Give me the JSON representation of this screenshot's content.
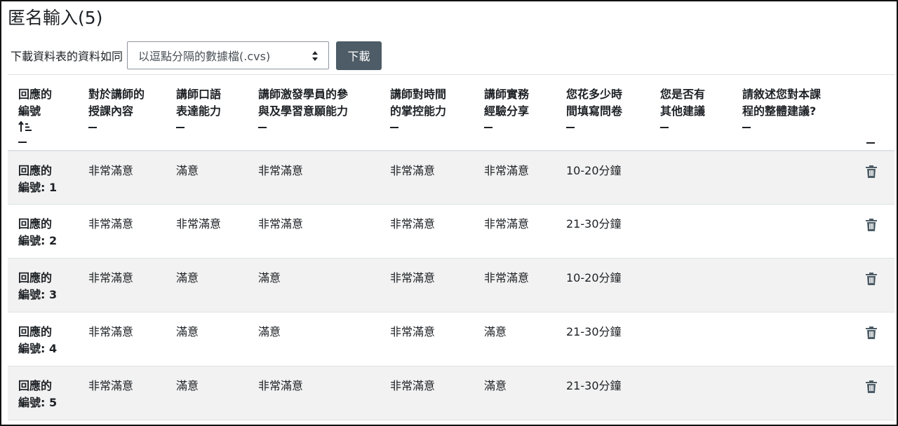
{
  "page": {
    "title": "匿名輸入(5)"
  },
  "download": {
    "label": "下載資料表的資料如同",
    "selected_format": "以逗點分隔的數據檔(.cvs)",
    "button_label": "下載"
  },
  "table": {
    "headers": [
      {
        "line1": "回應的",
        "line2": "編號"
      },
      {
        "line1": "對於講師的",
        "line2": "授課內容"
      },
      {
        "line1": "講師口語",
        "line2": "表達能力"
      },
      {
        "line1": "講師激發學員的參",
        "line2": "與及學習意願能力"
      },
      {
        "line1": "講師對時間",
        "line2": "的掌控能力"
      },
      {
        "line1": "講師實務",
        "line2": "經驗分享"
      },
      {
        "line1": "您花多少時",
        "line2": "間填寫問卷"
      },
      {
        "line1": "您是否有",
        "line2": "其他建議"
      },
      {
        "line1": "請敘述您對本課",
        "line2": "程的整體建議?"
      }
    ],
    "rows": [
      {
        "id_line1": "回應的",
        "id_line2": "編號: 1",
        "cells": [
          "非常滿意",
          "滿意",
          "非常滿意",
          "非常滿意",
          "非常滿意",
          "10-20分鐘",
          "",
          ""
        ]
      },
      {
        "id_line1": "回應的",
        "id_line2": "編號: 2",
        "cells": [
          "非常滿意",
          "非常滿意",
          "非常滿意",
          "非常滿意",
          "非常滿意",
          "21-30分鐘",
          "",
          ""
        ]
      },
      {
        "id_line1": "回應的",
        "id_line2": "編號: 3",
        "cells": [
          "非常滿意",
          "滿意",
          "滿意",
          "非常滿意",
          "非常滿意",
          "10-20分鐘",
          "",
          ""
        ]
      },
      {
        "id_line1": "回應的",
        "id_line2": "編號: 4",
        "cells": [
          "非常滿意",
          "滿意",
          "滿意",
          "非常滿意",
          "滿意",
          "21-30分鐘",
          "",
          ""
        ]
      },
      {
        "id_line1": "回應的",
        "id_line2": "編號: 5",
        "cells": [
          "非常滿意",
          "滿意",
          "非常滿意",
          "非常滿意",
          "滿意",
          "21-30分鐘",
          "",
          ""
        ]
      }
    ]
  },
  "icons": {
    "sort": "sort-ascending-icon",
    "delete": "trash-icon",
    "collapse": "collapse-dash-icon"
  },
  "colors": {
    "button_bg": "#4d5c66",
    "stripe": "#f2f2f2",
    "text": "#1d2125"
  }
}
